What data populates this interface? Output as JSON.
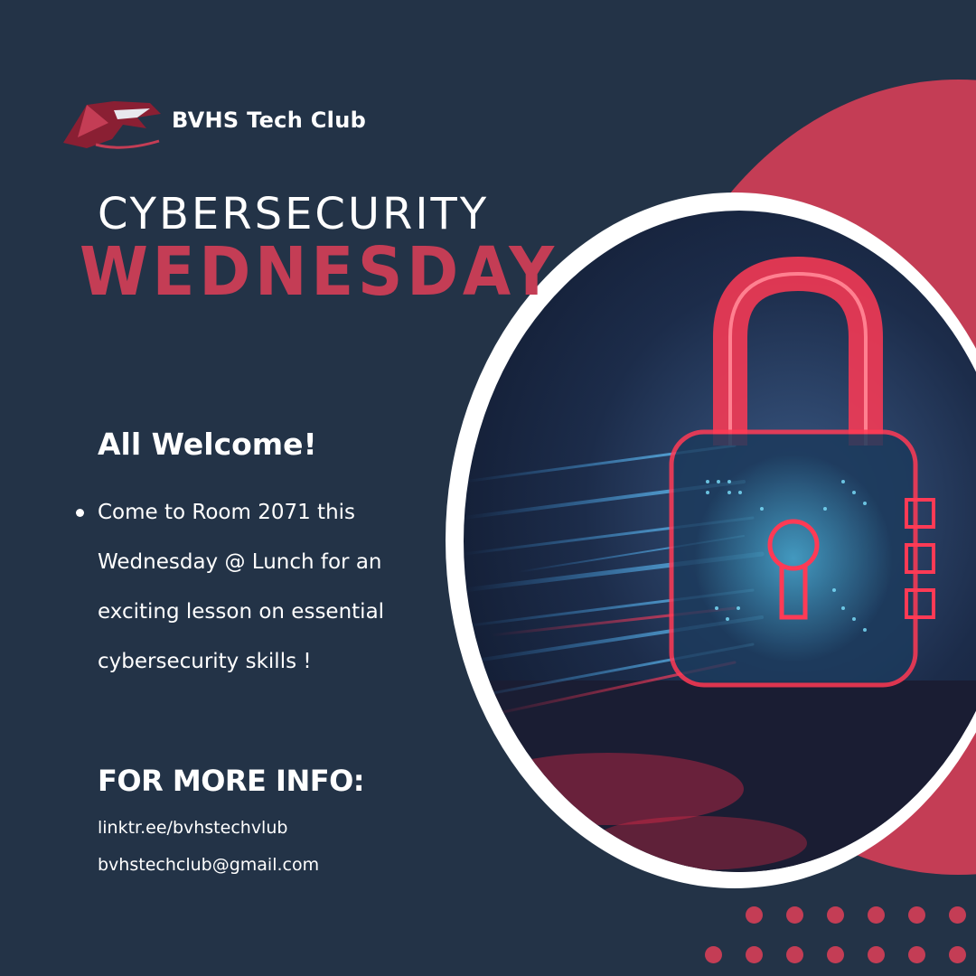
{
  "header": {
    "club_name": "BVHS Tech Club",
    "logo_icon": "shark-logo-icon"
  },
  "titles": {
    "line1": "CYBERSECURITY",
    "line2": "WEDNESDAY"
  },
  "welcome": {
    "heading": "All Welcome!",
    "bullet_lines": [
      "Come to Room 2071 this",
      "Wednesday @ Lunch for an",
      "exciting lesson on essential",
      "cybersecurity skills !"
    ]
  },
  "info": {
    "heading": "FOR MORE INFO:",
    "link": "linktr.ee/bvhstechvlub",
    "email": "bvhstechclub@gmail.com"
  },
  "image": {
    "icon": "padlock-icon"
  },
  "colors": {
    "background": "#233347",
    "accent": "#c43d55",
    "text": "#ffffff"
  }
}
